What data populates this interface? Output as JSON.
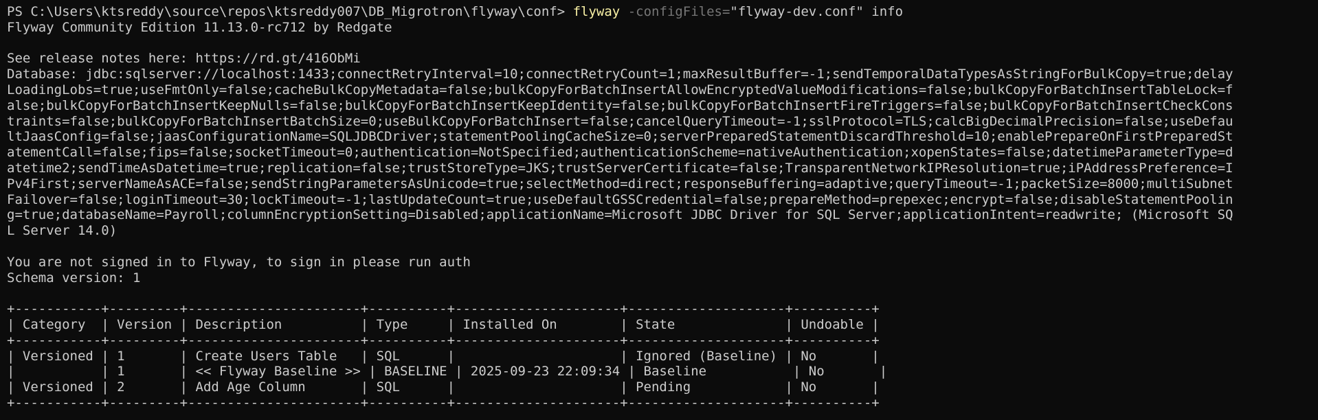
{
  "colors": {
    "background": "#0c0c0c",
    "text": "#cccccc",
    "command": "#f9f1a5",
    "parameter": "#767676"
  },
  "prompt": {
    "path": "PS C:\\Users\\ktsreddy\\source\\repos\\ktsreddy007\\DB_Migrotron\\flyway\\conf> ",
    "command": "flyway",
    "parameter": " -configFiles=",
    "argument": "\"flyway-dev.conf\" info"
  },
  "banner": "Flyway Community Edition 11.13.0-rc712 by Redgate",
  "release_notes": "See release notes here: https://rd.gt/416ObMi",
  "database_lines": [
    "Database: jdbc:sqlserver://localhost:1433;connectRetryInterval=10;connectRetryCount=1;maxResultBuffer=-1;sendTemporalDataTypesAsStringForBulkCopy=true;delay",
    "LoadingLobs=true;useFmtOnly=false;cacheBulkCopyMetadata=false;bulkCopyForBatchInsertAllowEncryptedValueModifications=false;bulkCopyForBatchInsertTableLock=f",
    "alse;bulkCopyForBatchInsertKeepNulls=false;bulkCopyForBatchInsertKeepIdentity=false;bulkCopyForBatchInsertFireTriggers=false;bulkCopyForBatchInsertCheckCons",
    "traints=false;bulkCopyForBatchInsertBatchSize=0;useBulkCopyForBatchInsert=false;cancelQueryTimeout=-1;sslProtocol=TLS;calcBigDecimalPrecision=false;useDefau",
    "ltJaasConfig=false;jaasConfigurationName=SQLJDBCDriver;statementPoolingCacheSize=0;serverPreparedStatementDiscardThreshold=10;enablePrepareOnFirstPreparedSt",
    "atementCall=false;fips=false;socketTimeout=0;authentication=NotSpecified;authenticationScheme=nativeAuthentication;xopenStates=false;datetimeParameterType=d",
    "atetime2;sendTimeAsDatetime=true;replication=false;trustStoreType=JKS;trustServerCertificate=false;TransparentNetworkIPResolution=true;iPAddressPreference=I",
    "Pv4First;serverNameAsACE=false;sendStringParametersAsUnicode=true;selectMethod=direct;responseBuffering=adaptive;queryTimeout=-1;packetSize=8000;multiSubnet",
    "Failover=false;loginTimeout=30;lockTimeout=-1;lastUpdateCount=true;useDefaultGSSCredential=false;prepareMethod=prepexec;encrypt=false;disableStatementPoolin",
    "g=true;databaseName=Payroll;columnEncryptionSetting=Disabled;applicationName=Microsoft JDBC Driver for SQL Server;applicationIntent=readwrite; (Microsoft SQ",
    "L Server 14.0)"
  ],
  "auth_notice": "You are not signed in to Flyway, to sign in please run auth",
  "schema_version": "Schema version: 1",
  "table": {
    "border": "+-----------+---------+----------------------+----------+---------------------+--------------------+----------+",
    "header": "| Category  | Version | Description          | Type     | Installed On        | State              | Undoable |",
    "rows": [
      "| Versioned | 1       | Create Users Table   | SQL      |                     | Ignored (Baseline) | No       |",
      "|           | 1       | << Flyway Baseline >> | BASELINE | 2025-09-23 22:09:34 | Baseline           | No       |",
      "| Versioned | 2       | Add Age Column       | SQL      |                     | Pending            | No       |"
    ]
  }
}
